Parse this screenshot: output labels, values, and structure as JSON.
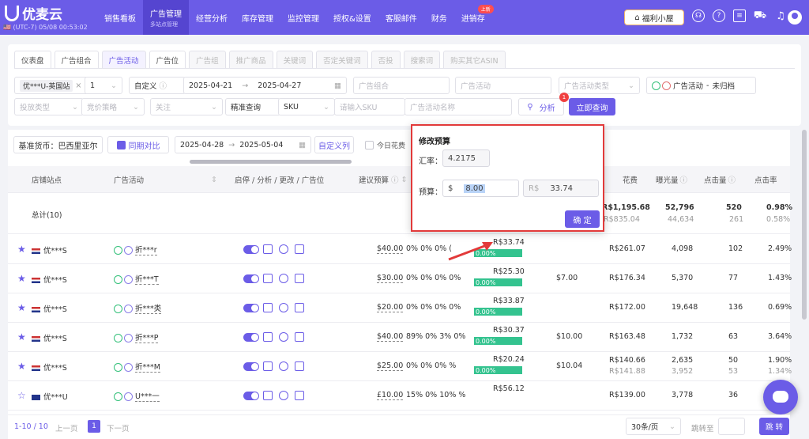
{
  "app": {
    "name": "优麦云",
    "clock": "(UTC-7) 05/08 00:53:02",
    "welfare": "福利小屋"
  },
  "nav": [
    {
      "label": "销售看板",
      "sub": ""
    },
    {
      "label": "广告管理",
      "sub": "多站点管理"
    },
    {
      "label": "经营分析",
      "sub": ""
    },
    {
      "label": "库存管理",
      "sub": ""
    },
    {
      "label": "监控管理",
      "sub": ""
    },
    {
      "label": "授权&设置",
      "sub": ""
    },
    {
      "label": "客服邮件",
      "sub": ""
    },
    {
      "label": "财务",
      "sub": ""
    },
    {
      "label": "进销存",
      "sub": "",
      "badge": "上新"
    }
  ],
  "tabs": [
    "仪表盘",
    "广告组合",
    "广告活动",
    "广告位",
    "广告组",
    "推广商品",
    "关键词",
    "否定关键词",
    "否投",
    "搜索词",
    "购买其它ASIN"
  ],
  "filters": {
    "shop_chip": "优***U-英国站",
    "shop_count": "1",
    "date_mode": "自定义",
    "date_from": "2025-04-21",
    "date_to": "2025-04-27",
    "ad_group_ph": "广告组合",
    "ad_campaign_ph": "广告活动",
    "ad_type_ph": "广告活动类型",
    "status_label": "广告活动",
    "status_value": "未归档",
    "delivery_ph": "投放类型",
    "bid_ph": "竞价策略",
    "follow_ph": "关注",
    "query_mode": "精准查询",
    "sku_field": "SKU",
    "sku_ph": "请输入SKU",
    "campaign_name_ph": "广告活动名称",
    "analyze": "分析",
    "query_btn": "立即查询",
    "badge": "1"
  },
  "toolbar": {
    "currency": "基准货币：巴西里亚尔",
    "compare": "同期对比",
    "cmp_from": "2025-04-28",
    "cmp_to": "2025-05-04",
    "custom_cols": "自定义列",
    "today_spend": "今日花费"
  },
  "headers": {
    "shop": "店铺站点",
    "campaign": "广告活动",
    "ops": "启停 / 分析 / 更改 / 广告位",
    "budget": "建议预算",
    "spend": "花费",
    "impr": "曝光量",
    "clicks": "点击量",
    "ctr": "点击率"
  },
  "total": {
    "label": "总计(10)",
    "spend": "R$1,195.68",
    "spend_prev": "R$835.04",
    "impr": "52,796",
    "impr_prev": "44,634",
    "clicks": "520",
    "clicks_prev": "261",
    "ctr": "0.98%",
    "ctr_prev": "0.58%"
  },
  "rows": [
    {
      "flag": "us",
      "star": "★",
      "shop": "优***S",
      "campaign": "折***r",
      "budget": "$40.00",
      "pcts": "0%  0%  0%  (",
      "rbudget": "R$33.74",
      "green": "0.00%",
      "extra": "",
      "spend": "R$261.07",
      "spend_prev": "",
      "impr": "4,098",
      "impr_prev": "",
      "clicks": "102",
      "clicks_prev": "",
      "ctr": "2.49%",
      "ctr_prev": ""
    },
    {
      "flag": "us",
      "star": "★",
      "shop": "优***S",
      "campaign": "折***T",
      "budget": "$30.00",
      "pcts": "0%  0%  0%  0%",
      "rbudget": "R$25.30",
      "green": "0.00%",
      "extra": "$7.00",
      "spend": "R$176.34",
      "spend_prev": "",
      "impr": "5,370",
      "impr_prev": "",
      "clicks": "77",
      "clicks_prev": "",
      "ctr": "1.43%",
      "ctr_prev": ""
    },
    {
      "flag": "us",
      "star": "★",
      "shop": "优***S",
      "campaign": "折***类",
      "budget": "$20.00",
      "pcts": "0%  0%  0%  0%",
      "rbudget": "R$33.87",
      "green": "0.00%",
      "extra": "",
      "spend": "R$172.00",
      "spend_prev": "",
      "impr": "19,648",
      "impr_prev": "",
      "clicks": "136",
      "clicks_prev": "",
      "ctr": "0.69%",
      "ctr_prev": ""
    },
    {
      "flag": "us",
      "star": "★",
      "shop": "优***S",
      "campaign": "折***P",
      "budget": "$40.00",
      "pcts": "89%  0%  3%  0%",
      "rbudget": "R$30.37",
      "green": "0.00%",
      "extra": "$10.00",
      "spend": "R$163.48",
      "spend_prev": "",
      "impr": "1,732",
      "impr_prev": "",
      "clicks": "63",
      "clicks_prev": "",
      "ctr": "3.64%",
      "ctr_prev": ""
    },
    {
      "flag": "us",
      "star": "★",
      "shop": "优***S",
      "campaign": "折***M",
      "budget": "$25.00",
      "pcts": "0%  0%  0%  %",
      "rbudget": "R$20.24",
      "green": "0.00%",
      "extra": "$10.04",
      "spend": "R$140.66",
      "spend_prev": "R$141.88",
      "impr": "2,635",
      "impr_prev": "3,952",
      "clicks": "50",
      "clicks_prev": "53",
      "ctr": "1.90%",
      "ctr_prev": "1.34%"
    },
    {
      "flag": "uk",
      "star": "☆",
      "shop": "优***U",
      "campaign": "U***一",
      "budget": "£10.00",
      "pcts": "15%  0%  10%  %",
      "rbudget": "R$56.12",
      "green": "",
      "extra": "",
      "spend": "R$139.00",
      "spend_prev": "",
      "impr": "3,778",
      "impr_prev": "",
      "clicks": "36",
      "clicks_prev": "",
      "ctr": "",
      "ctr_prev": ""
    }
  ],
  "popup": {
    "title": "修改预算",
    "rate_label": "汇率：",
    "rate": "4.2175",
    "budget_label": "预算：",
    "currency1": "$",
    "budget_value": "8.00",
    "currency2": "R$",
    "converted": "33.74",
    "confirm": "确 定"
  },
  "footer": {
    "page_info": "1-10 / 10",
    "prev": "上一页",
    "page": "1",
    "next": "下一页",
    "page_size": "30条/页",
    "goto": "跳转至",
    "go": "跳 转"
  }
}
